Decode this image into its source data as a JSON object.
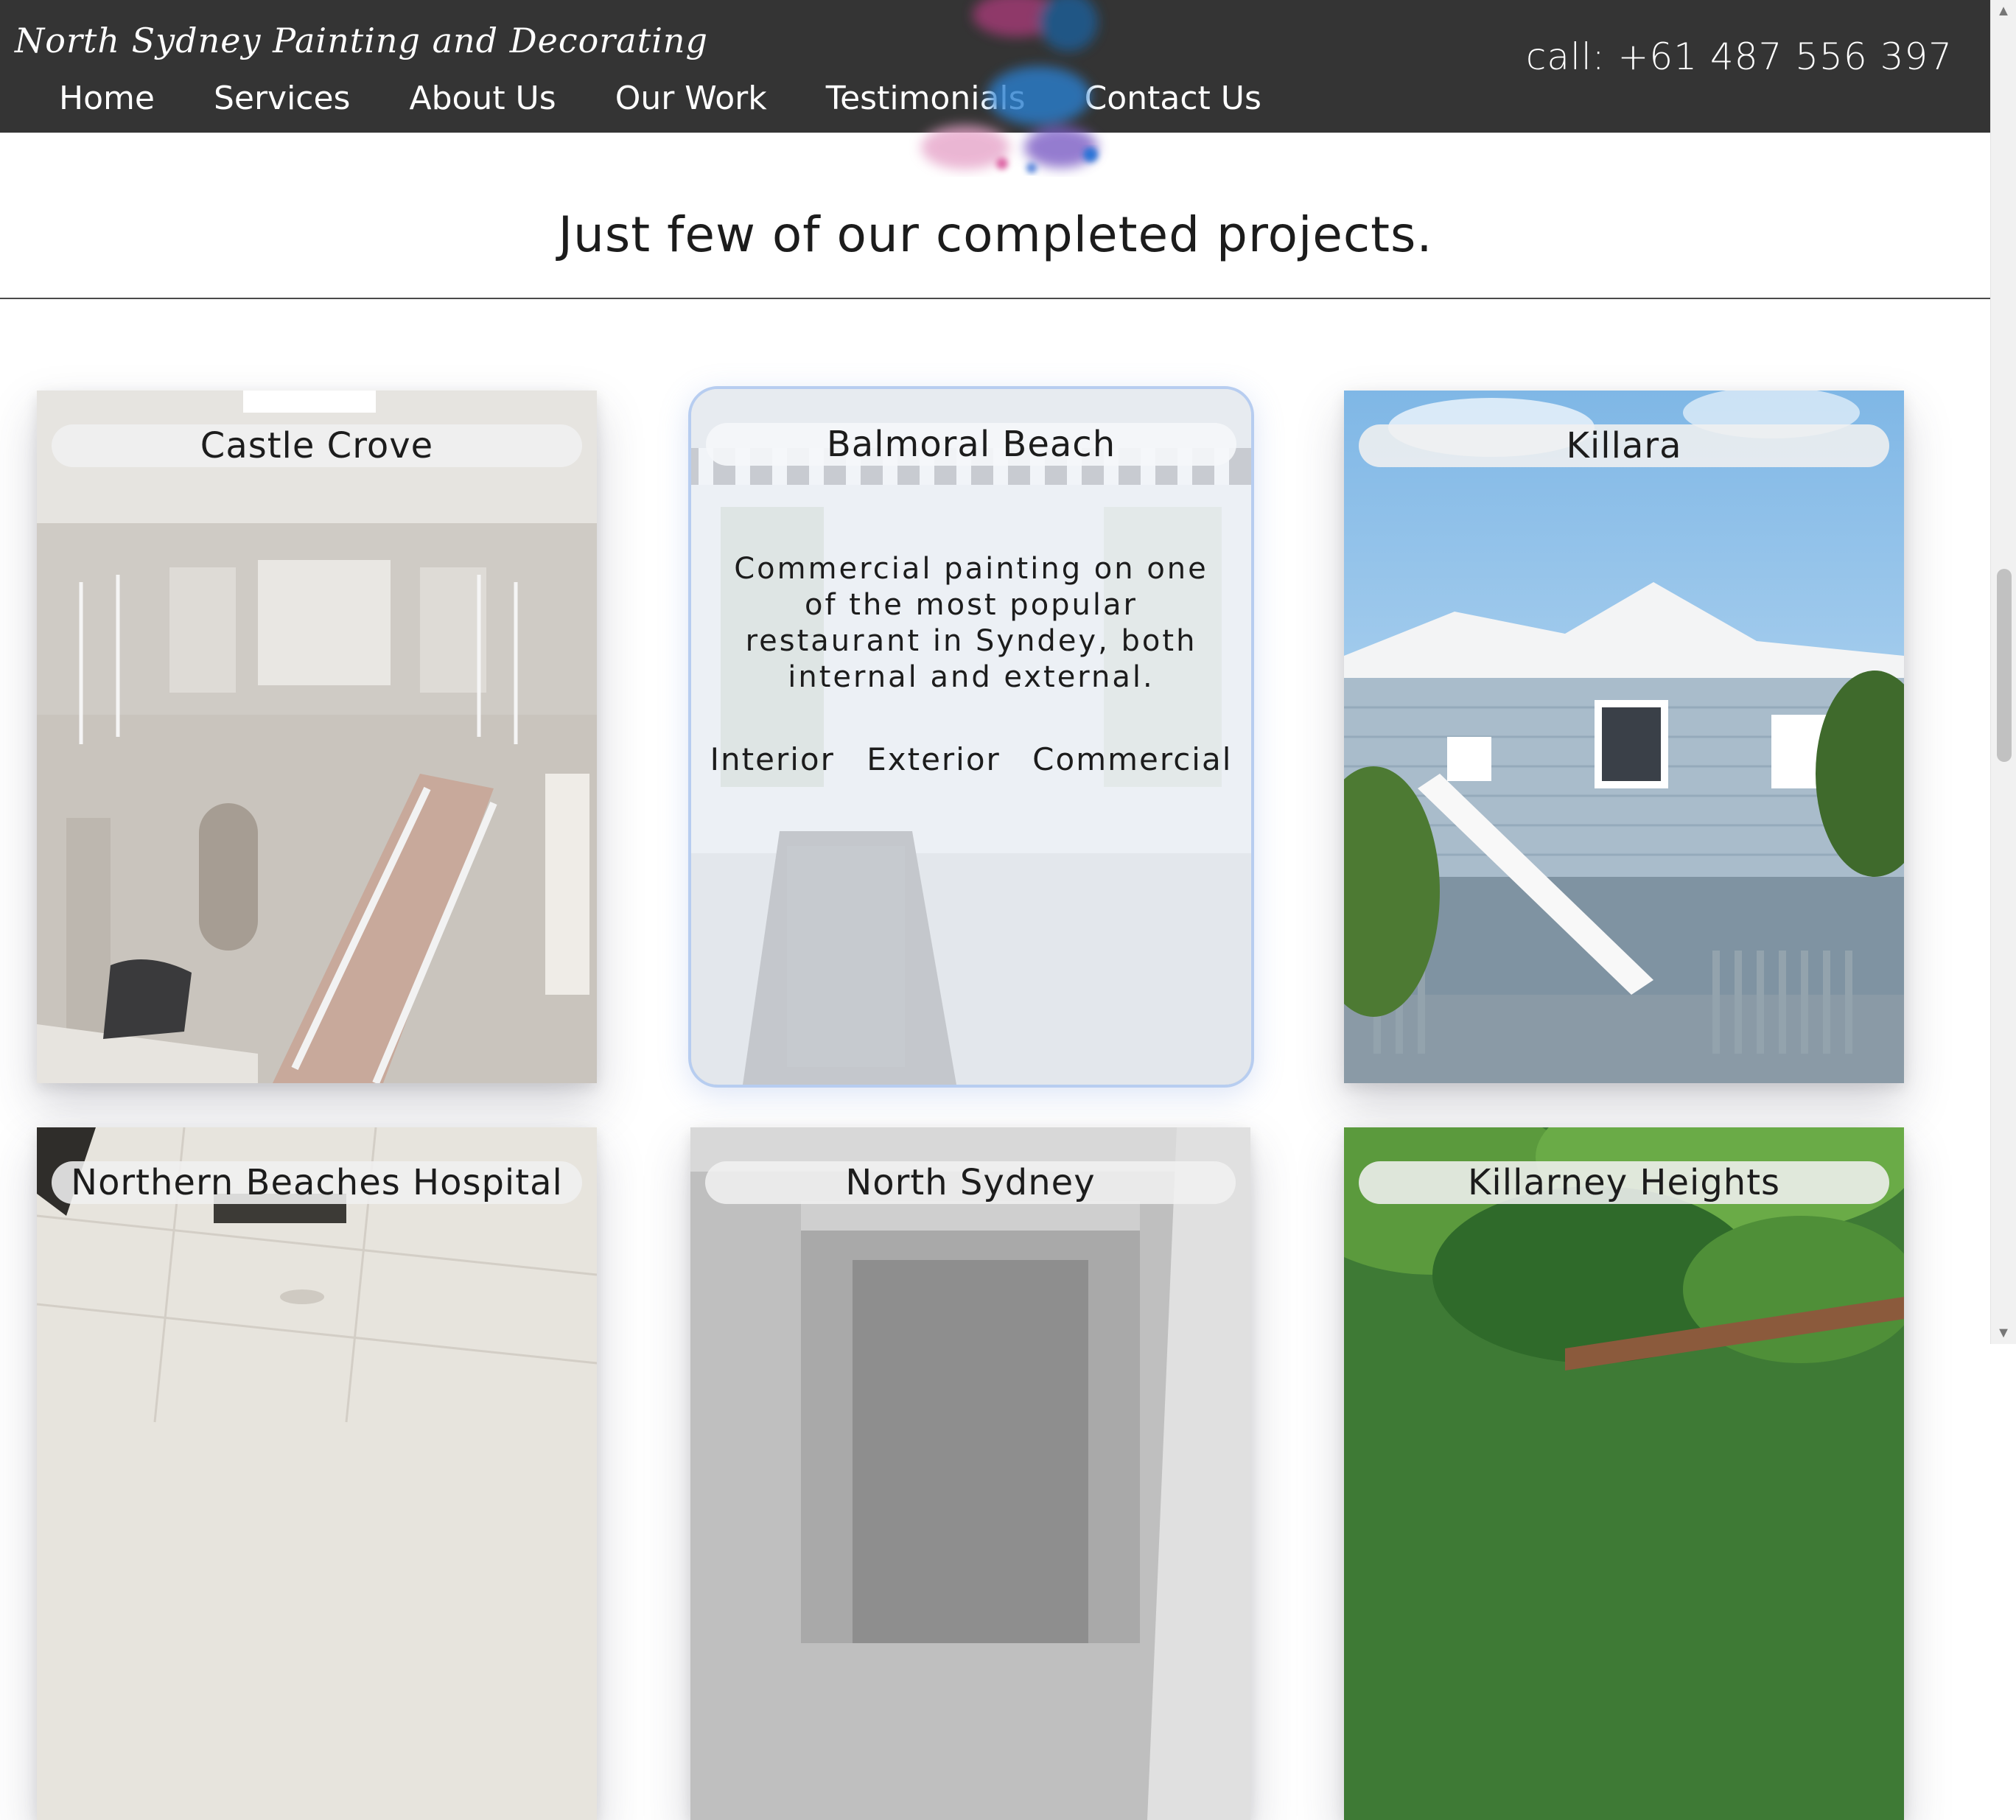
{
  "header": {
    "brand": "North Sydney Painting and Decorating",
    "phone": "call: +61 487 556 397",
    "nav": [
      "Home",
      "Services",
      "About Us",
      "Our Work",
      "Testimonials",
      "Contact Us"
    ]
  },
  "section": {
    "title": "Just few of our completed projects."
  },
  "projects": [
    {
      "name": "Castle Crove"
    },
    {
      "name": "Balmoral Beach",
      "description": "Commercial painting on one of the most popular restaurant in Syndey, both internal and external.",
      "tags": [
        "Interior",
        "Exterior",
        "Commercial"
      ]
    },
    {
      "name": "Killara"
    },
    {
      "name": "Northern Beaches Hospital"
    },
    {
      "name": "North Sydney"
    },
    {
      "name": "Killarney Heights"
    }
  ],
  "icons": {
    "scroll_up": "chevron-up-icon",
    "scroll_down": "chevron-down-icon"
  },
  "colors": {
    "header_bg": "#343434",
    "hover_border": "#b7cdf0"
  }
}
